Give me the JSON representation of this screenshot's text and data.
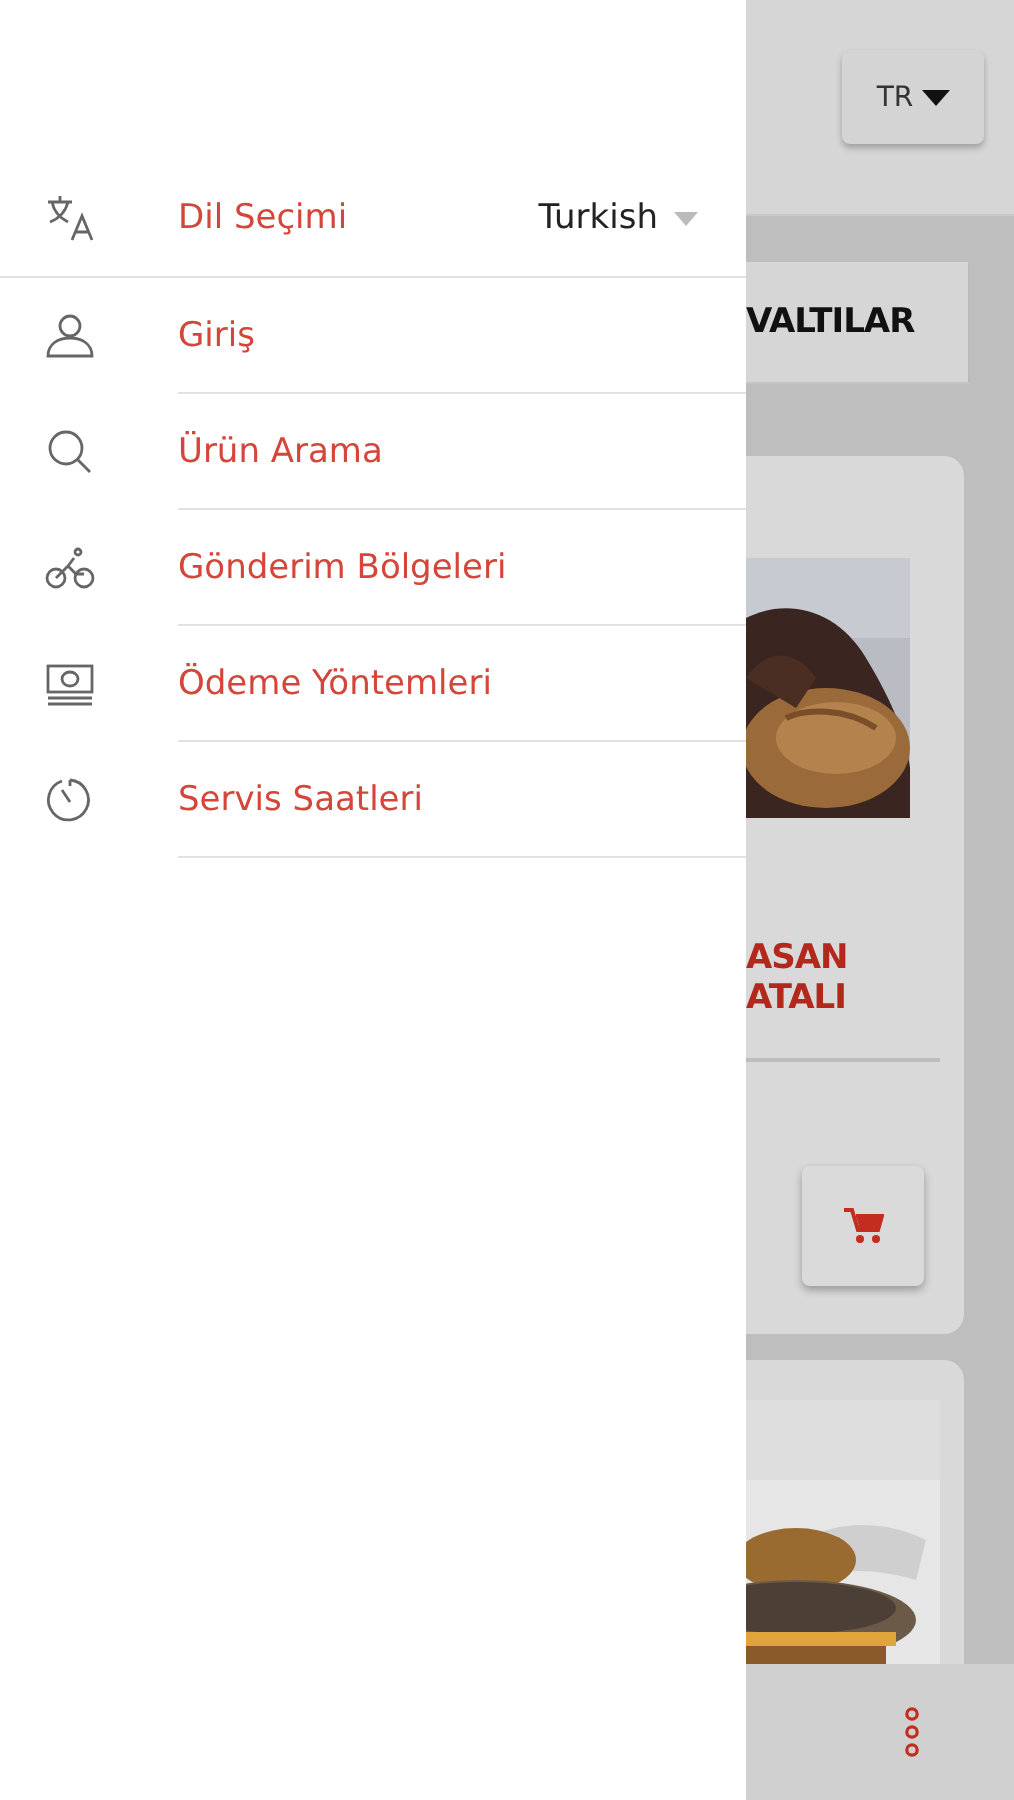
{
  "drawer": {
    "language": {
      "label": "Dil Seçimi",
      "value": "Turkish"
    },
    "items": [
      {
        "label": "Giriş"
      },
      {
        "label": "Ürün Arama"
      },
      {
        "label": "Gönderim Bölgeleri"
      },
      {
        "label": "Ödeme Yöntemleri"
      },
      {
        "label": "Servis Saatleri"
      }
    ]
  },
  "background": {
    "language_button": "TR",
    "tab": "VALTILAR",
    "product_title": [
      "ASAN",
      "ATALI"
    ]
  }
}
